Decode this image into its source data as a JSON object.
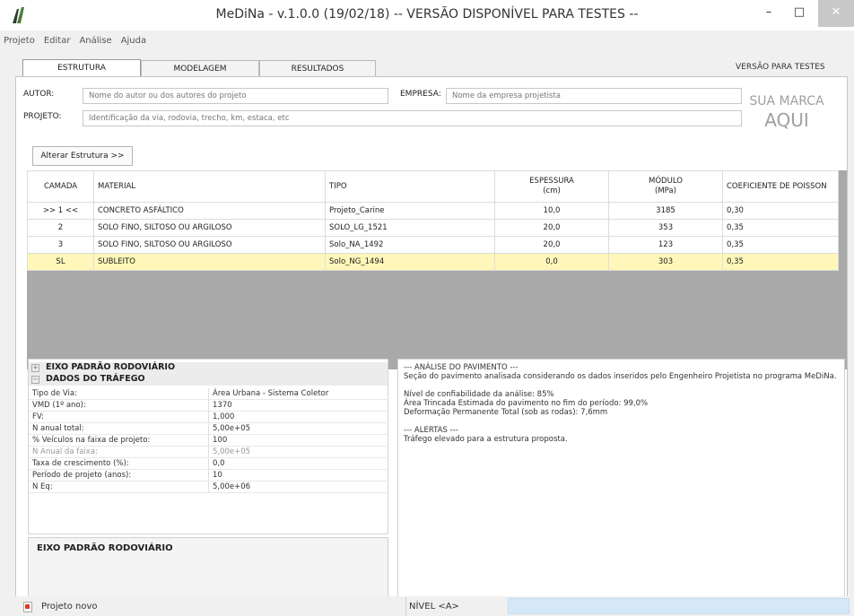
{
  "window": {
    "title": "MeDiNa - v.1.0.0 (19/02/18) -- VERSÃO DISPONÍVEL PARA TESTES --",
    "minimize": "–",
    "maximize": "□",
    "close": "✕"
  },
  "menu": [
    "Projeto",
    "Editar",
    "Análise",
    "Ajuda"
  ],
  "tabs": [
    "ESTRUTURA",
    "MODELAGEM",
    "RESULTADOS"
  ],
  "active_tab": "ESTRUTURA",
  "version_label": "VERSÃO PARA TESTES",
  "form": {
    "autor_label": "AUTOR:",
    "autor_placeholder": "Nome do autor ou dos autores do projeto",
    "empresa_label": "EMPRESA:",
    "empresa_placeholder": "Nome da empresa projetista",
    "projeto_label": "PROJETO:",
    "projeto_placeholder": "Identificação da via, rodovia, trecho, km, estaca, etc"
  },
  "brand": {
    "line1": "SUA MARCA",
    "line2": "AQUI"
  },
  "alterar_button": "Alterar Estrutura >>",
  "layers": {
    "headers": {
      "camada": "CAMADA",
      "material": "MATERIAL",
      "tipo": "TIPO",
      "espessura": "ESPESSURA",
      "espessura_unit": "(cm)",
      "modulo": "MÓDULO",
      "modulo_unit": "(MPa)",
      "poisson": "COEFICIENTE DE POISSON"
    },
    "rows": [
      {
        "camada": ">> 1 <<",
        "material": "CONCRETO ASFÁLTICO",
        "tipo": "Projeto_Carine",
        "espessura": "10,0",
        "modulo": "3185",
        "poisson": "0,30"
      },
      {
        "camada": "2",
        "material": "SOLO FINO, SILTOSO OU ARGILOSO",
        "tipo": "SOLO_LG_1521",
        "espessura": "20,0",
        "modulo": "353",
        "poisson": "0,35"
      },
      {
        "camada": "3",
        "material": "SOLO FINO, SILTOSO OU ARGILOSO",
        "tipo": "Solo_NA_1492",
        "espessura": "20,0",
        "modulo": "123",
        "poisson": "0,35"
      },
      {
        "camada": "SL",
        "material": "SUBLEITO",
        "tipo": "Solo_NG_1494",
        "espessura": "0,0",
        "modulo": "303",
        "poisson": "0,35"
      }
    ],
    "selected_row": 3
  },
  "traffic": {
    "group1": "EIXO PADRÃO RODOVIÁRIO",
    "group2": "DADOS DO TRÁFEGO",
    "toggle1": "+",
    "toggle2": "−",
    "rows": [
      {
        "k": "Tipo de Via:",
        "v": "Área Urbana - Sistema Coletor"
      },
      {
        "k": "VMD (1º ano):",
        "v": "1370"
      },
      {
        "k": "FV:",
        "v": "1,000"
      },
      {
        "k": "N anual total:",
        "v": "5,00e+05"
      },
      {
        "k": "% Veículos na faixa de projeto:",
        "v": "100"
      },
      {
        "k": "N Anual da faixa:",
        "v": "5,00e+05"
      },
      {
        "k": "Taxa de crescimento (%):",
        "v": "0,0"
      },
      {
        "k": "Período de projeto (anos):",
        "v": "10"
      },
      {
        "k": "N Eq:",
        "v": "5,00e+06"
      }
    ],
    "description_title": "EIXO PADRÃO RODOVIÁRIO"
  },
  "analysis": {
    "title": "--- ANÁLISE DO PAVIMENTO ---",
    "intro": "Seção do pavimento analisada considerando os dados inseridos pelo Engenheiro Projetista no programa MeDiNa.",
    "confiabilidade": "Nível de confiabilidade da análise: 85%",
    "area_trincada": "Área Trincada Estimada do pavimento no fim do período: 99,0%",
    "deformacao": "Deformação Permanente Total (sob as rodas): 7,6mm",
    "alertas_title": "--- ALERTAS ---",
    "alerta1": "Tráfego elevado para a estrutura proposta."
  },
  "status": {
    "text": "Projeto novo",
    "nivel": "NÍVEL <A>"
  }
}
